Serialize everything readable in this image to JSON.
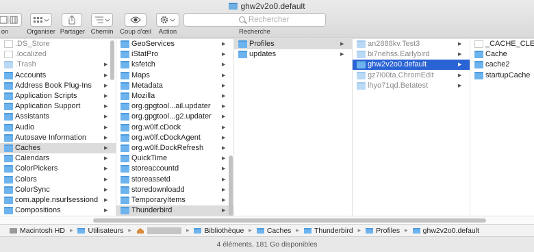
{
  "window": {
    "title": "ghw2v2o0.default"
  },
  "toolbar": {
    "view_label": "on",
    "organise_label": "Organiser",
    "share_label": "Partager",
    "path_label": "Chemin",
    "quicklook_label": "Coup d'œil",
    "action_label": "Action",
    "search_placeholder": "Rechercher",
    "search_label": "Recherche"
  },
  "columns": {
    "col1": [
      {
        "name": ".DS_Store",
        "kind": "doc",
        "dim": true
      },
      {
        "name": ".localized",
        "kind": "doc",
        "dim": true
      },
      {
        "name": ".Trash",
        "kind": "folder",
        "dim": true,
        "arrow": true
      },
      {
        "name": "Accounts",
        "kind": "folder",
        "arrow": true
      },
      {
        "name": "Address Book Plug-Ins",
        "kind": "folder",
        "arrow": true
      },
      {
        "name": "Application Scripts",
        "kind": "folder",
        "arrow": true
      },
      {
        "name": "Application Support",
        "kind": "folder",
        "arrow": true
      },
      {
        "name": "Assistants",
        "kind": "folder",
        "arrow": true
      },
      {
        "name": "Audio",
        "kind": "folder",
        "arrow": true
      },
      {
        "name": "Autosave Information",
        "kind": "folder",
        "arrow": true
      },
      {
        "name": "Caches",
        "kind": "folder",
        "arrow": true,
        "selected": true
      },
      {
        "name": "Calendars",
        "kind": "folder",
        "arrow": true
      },
      {
        "name": "ColorPickers",
        "kind": "folder",
        "arrow": true
      },
      {
        "name": "Colors",
        "kind": "folder",
        "arrow": true
      },
      {
        "name": "ColorSync",
        "kind": "folder",
        "arrow": true
      },
      {
        "name": "com.apple.nsurlsessiond",
        "kind": "folder",
        "arrow": true
      },
      {
        "name": "Compositions",
        "kind": "folder",
        "arrow": true
      }
    ],
    "col2": [
      {
        "name": "GeoServices",
        "kind": "folder",
        "arrow": true
      },
      {
        "name": "iStatPro",
        "kind": "folder",
        "arrow": true
      },
      {
        "name": "ksfetch",
        "kind": "folder",
        "arrow": true
      },
      {
        "name": "Maps",
        "kind": "folder",
        "arrow": true
      },
      {
        "name": "Metadata",
        "kind": "folder",
        "arrow": true
      },
      {
        "name": "Mozilla",
        "kind": "folder",
        "arrow": true
      },
      {
        "name": "org.gpgtool...ail.updater",
        "kind": "folder",
        "arrow": true
      },
      {
        "name": "org.gpgtool...g2.updater",
        "kind": "folder",
        "arrow": true
      },
      {
        "name": "org.w0lf.cDock",
        "kind": "folder",
        "arrow": true
      },
      {
        "name": "org.w0lf.cDockAgent",
        "kind": "folder",
        "arrow": true
      },
      {
        "name": "org.w0lf.DockRefresh",
        "kind": "folder",
        "arrow": true
      },
      {
        "name": "QuickTime",
        "kind": "folder",
        "arrow": true
      },
      {
        "name": "storeaccountd",
        "kind": "folder",
        "arrow": true
      },
      {
        "name": "storeassetd",
        "kind": "folder",
        "arrow": true
      },
      {
        "name": "storedownloadd",
        "kind": "folder",
        "arrow": true
      },
      {
        "name": "TemporaryItems",
        "kind": "folder",
        "arrow": true
      },
      {
        "name": "Thunderbird",
        "kind": "folder",
        "arrow": true,
        "selected": true
      }
    ],
    "col3": [
      {
        "name": "Profiles",
        "kind": "folder",
        "arrow": true,
        "selected": true
      },
      {
        "name": "updates",
        "kind": "folder",
        "arrow": true
      }
    ],
    "col4": [
      {
        "name": "an2888kv.Test3",
        "kind": "folder",
        "dim": true,
        "arrow": true
      },
      {
        "name": "bi7nehss.Earlybird",
        "kind": "folder",
        "dim": true,
        "arrow": true
      },
      {
        "name": "ghw2v2o0.default",
        "kind": "folder",
        "arrow": true,
        "active": true
      },
      {
        "name": "gz7i00ta.ChromEdit",
        "kind": "folder",
        "dim": true,
        "arrow": true
      },
      {
        "name": "lhyo71qd.Betatest",
        "kind": "folder",
        "dim": true,
        "arrow": true
      }
    ],
    "col5": [
      {
        "name": "_CACHE_CLEAN_",
        "kind": "doc"
      },
      {
        "name": "Cache",
        "kind": "folder"
      },
      {
        "name": "cache2",
        "kind": "folder"
      },
      {
        "name": "startupCache",
        "kind": "folder"
      }
    ]
  },
  "pathbar": {
    "items": [
      "Macintosh HD",
      "Utilisateurs",
      "Bibliothèque",
      "Caches",
      "Thunderbird",
      "Profiles",
      "ghw2v2o0.default"
    ]
  },
  "status": {
    "text": "4 éléments, 181 Go disponibles"
  },
  "colors": {
    "selection_active": "#2a63d4",
    "selection_inactive": "#dcdcdc",
    "folder": "#6db3ee"
  }
}
